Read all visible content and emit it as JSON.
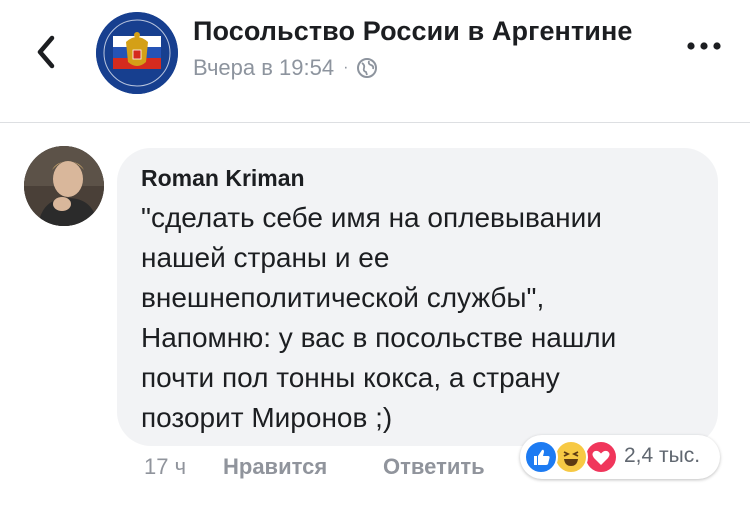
{
  "header": {
    "page_name": "Посольство России в Аргентине",
    "timestamp": "Вчера в 19:54",
    "separator": "·",
    "privacy_icon": "globe-icon",
    "back_icon": "chevron-left-icon",
    "more_icon": "more-dots-icon"
  },
  "comment": {
    "author": "Roman Kriman",
    "text_lines": [
      "\"сделать себе имя на оплевывании",
      "нашей страны и ее",
      "внешнеполитической службы\",",
      "Напомню: у вас в посольстве нашли",
      "почти пол тонны кокса, а страну",
      "позорит Миронов ;)"
    ],
    "time": "17 ч",
    "like_label": "Нравится",
    "reply_label": "Ответить",
    "reactions": {
      "icons": [
        "like-icon",
        "haha-icon",
        "love-icon"
      ],
      "count": "2,4 тыс."
    }
  },
  "colors": {
    "bubble": "#f2f3f5",
    "like_blue": "#1d7bf2",
    "love_red": "#f0365b",
    "haha_yellow": "#f7c944",
    "muted_text": "#90949c"
  }
}
